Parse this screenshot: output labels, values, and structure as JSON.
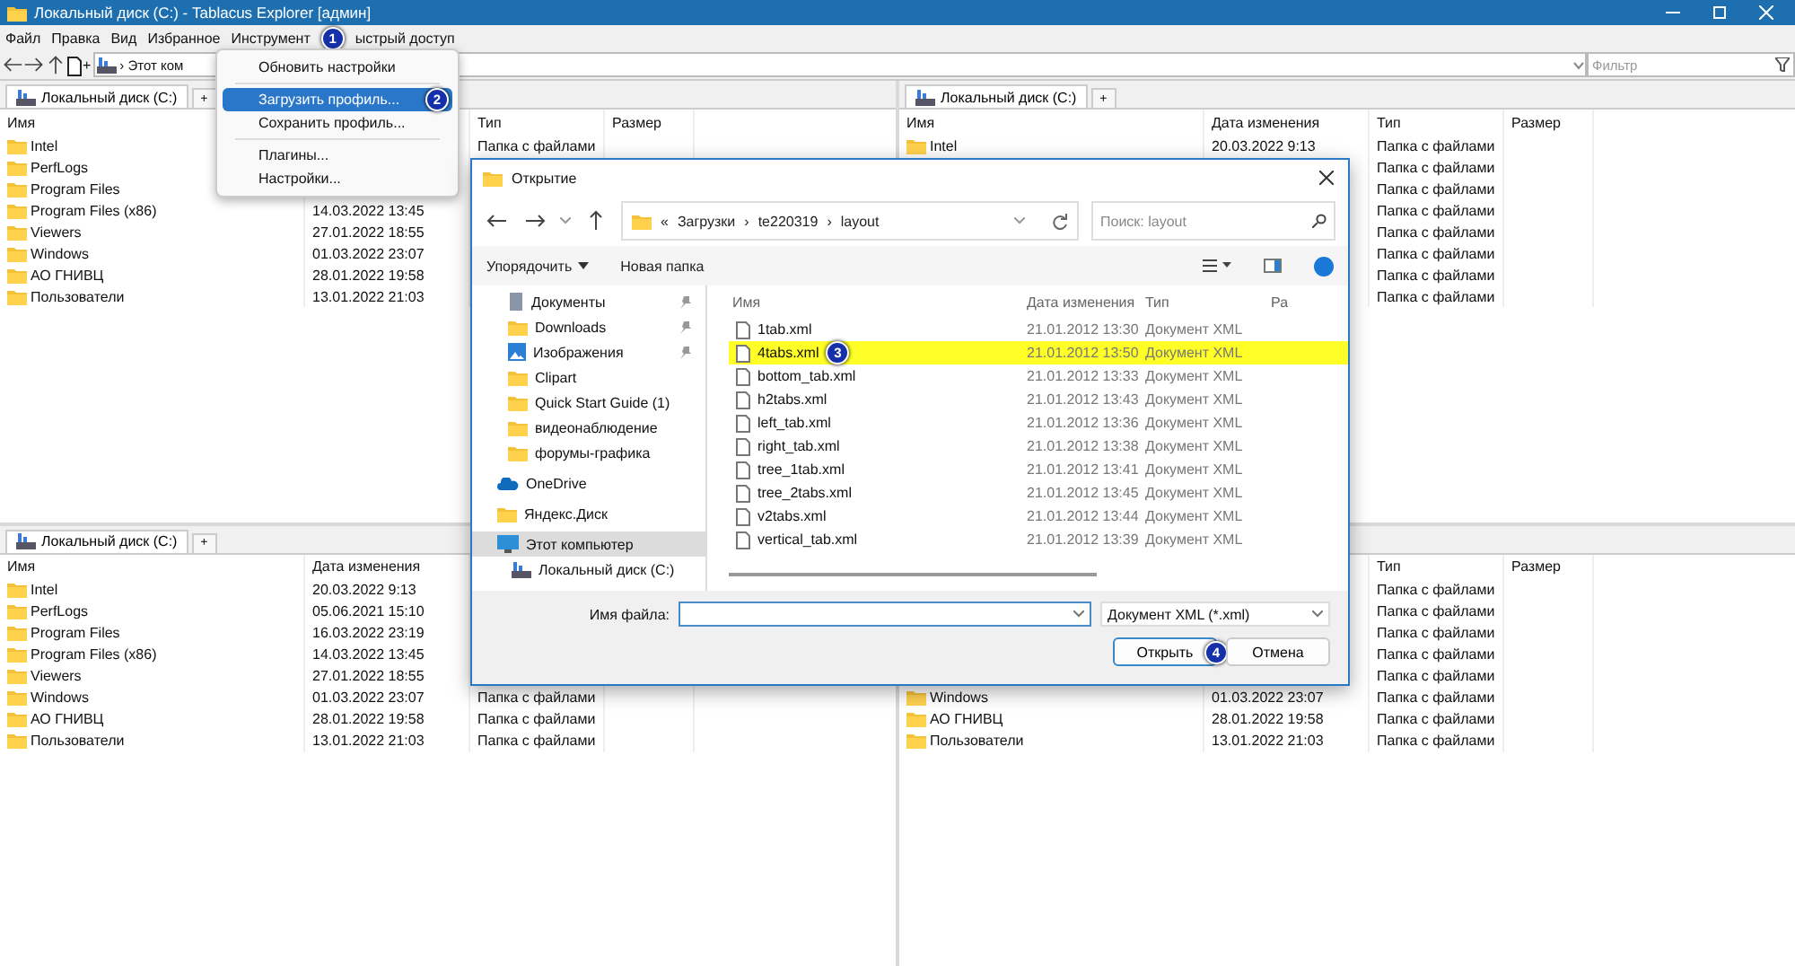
{
  "window": {
    "title": "Локальный диск (C:) - Tablacus Explorer [админ]"
  },
  "menu_bar": [
    {
      "label": "Файл"
    },
    {
      "label": "Правка"
    },
    {
      "label": "Вид"
    },
    {
      "label": "Избранное"
    },
    {
      "label": "Инструмент",
      "badge": "1"
    },
    {
      "label": "ыстрый доступ"
    }
  ],
  "toolbar": {
    "new_tab": "+",
    "address": "› Этот ком",
    "filter_placeholder": "Фильтр"
  },
  "panes": [
    {
      "tab": "Локальный диск (C:)",
      "add_tab": "+",
      "columns": {
        "name": "Имя",
        "type": "Тип",
        "size": "Размер"
      },
      "rows": [
        {
          "name": "Intel",
          "type": "Папка с файлами"
        },
        {
          "name": "PerfLogs"
        },
        {
          "name": "Program Files"
        },
        {
          "name": "Program Files (x86)",
          "date": "14.03.2022 13:45"
        },
        {
          "name": "Viewers",
          "date": "27.01.2022 18:55"
        },
        {
          "name": "Windows",
          "date": "01.03.2022 23:07"
        },
        {
          "name": "АО ГНИВЦ",
          "date": "28.01.2022 19:58"
        },
        {
          "name": "Пользователи",
          "date": "13.01.2022 21:03"
        }
      ]
    },
    {
      "tab": "Локальный диск (C:)",
      "add_tab": "+",
      "columns": {
        "name": "Имя",
        "date": "Дата изменения",
        "type": "Тип",
        "size": "Размер"
      },
      "rows": [
        {
          "name": "Intel",
          "date": "20.03.2022 9:13",
          "type": "Папка с файлами"
        },
        {
          "type": "Папка с файлами"
        },
        {
          "type": "Папка с файлами"
        },
        {
          "type": "Папка с файлами"
        },
        {
          "type": "Папка с файлами"
        },
        {
          "type": "Папка с файлами"
        },
        {
          "type": "Папка с файлами"
        },
        {
          "type": "Папка с файлами"
        }
      ]
    },
    {
      "tab": "Локальный диск (C:)",
      "add_tab": "+",
      "columns": {
        "name": "Имя",
        "date": "Дата изменения"
      },
      "rows": [
        {
          "name": "Intel",
          "date": "20.03.2022 9:13"
        },
        {
          "name": "PerfLogs",
          "date": "05.06.2021 15:10"
        },
        {
          "name": "Program Files",
          "date": "16.03.2022 23:19"
        },
        {
          "name": "Program Files (x86)",
          "date": "14.03.2022 13:45"
        },
        {
          "name": "Viewers",
          "date": "27.01.2022 18:55"
        },
        {
          "name": "Windows",
          "date": "01.03.2022 23:07",
          "type": "Папка с файлами"
        },
        {
          "name": "АО ГНИВЦ",
          "date": "28.01.2022 19:58",
          "type": "Папка с файлами"
        },
        {
          "name": "Пользователи",
          "date": "13.01.2022 21:03",
          "type": "Папка с файлами"
        }
      ]
    },
    {
      "columns": {
        "type": "Тип",
        "size": "Размер"
      },
      "rows": [
        {
          "type": "Папка с файлами"
        },
        {
          "type": "Папка с файлами"
        },
        {
          "type": "Папка с файлами"
        },
        {
          "type": "Папка с файлами"
        },
        {
          "type": "Папка с файлами"
        },
        {
          "name": "Windows",
          "date": "01.03.2022 23:07",
          "type": "Папка с файлами"
        },
        {
          "name": "АО ГНИВЦ",
          "date": "28.01.2022 19:58",
          "type": "Папка с файлами"
        },
        {
          "name": "Пользователи",
          "date": "13.01.2022 21:03",
          "type": "Папка с файлами"
        }
      ]
    }
  ],
  "tools_menu": [
    {
      "kind": "item",
      "label": "Обновить настройки",
      "highlighted": false
    },
    {
      "kind": "separator"
    },
    {
      "kind": "item",
      "label": "Загрузить профиль...",
      "highlighted": true,
      "badge": "2"
    },
    {
      "kind": "item",
      "label": "Сохранить профиль...",
      "highlighted": false
    },
    {
      "kind": "separator"
    },
    {
      "kind": "item",
      "label": "Плагины...",
      "highlighted": false
    },
    {
      "kind": "item",
      "label": "Настройки...",
      "highlighted": false
    }
  ],
  "open_dialog": {
    "title": "Открытие",
    "path": [
      {
        "label": "Загрузки"
      },
      {
        "label": "te220319"
      },
      {
        "label": "layout"
      }
    ],
    "path_overflow": "«",
    "path_separator": "›",
    "search_placeholder": "Поиск: layout",
    "organize": "Упорядочить",
    "new_folder": "Новая папка",
    "nav": [
      {
        "kind": "documents",
        "label": "Документы",
        "pinned": true,
        "selected": false
      },
      {
        "kind": "folder",
        "label": "Downloads",
        "pinned": true,
        "selected": false
      },
      {
        "kind": "pictures",
        "label": "Изображения",
        "pinned": true,
        "selected": false
      },
      {
        "kind": "folder",
        "label": "Clipart",
        "pinned": false,
        "selected": false
      },
      {
        "kind": "folder",
        "label": "Quick Start Guide (1)",
        "pinned": false,
        "selected": false
      },
      {
        "kind": "folder",
        "label": "видеонаблюдение",
        "pinned": false,
        "selected": false
      },
      {
        "kind": "folder",
        "label": "форумы-графика",
        "pinned": false,
        "selected": false
      },
      {
        "kind": "onedrive",
        "label": "OneDrive",
        "pinned": false,
        "selected": false,
        "top": true
      },
      {
        "kind": "folder",
        "label": "Яндекс.Диск",
        "pinned": false,
        "selected": false,
        "top": true
      },
      {
        "kind": "pc",
        "label": "Этот компьютер",
        "pinned": false,
        "selected": true,
        "top": true,
        "children": [
          {
            "kind": "drive",
            "label": "Локальный диск (C:)",
            "pinned": false,
            "selected": false
          }
        ]
      }
    ],
    "columns": [
      "Имя",
      "Дата изменения",
      "Тип",
      "Ра"
    ],
    "files": [
      {
        "name": "1tab.xml",
        "date": "21.01.2012 13:30",
        "type": "Документ XML",
        "highlighted": false
      },
      {
        "name": "4tabs.xml",
        "date": "21.01.2012 13:50",
        "type": "Документ XML",
        "highlighted": true,
        "badge": "3"
      },
      {
        "name": "bottom_tab.xml",
        "date": "21.01.2012 13:33",
        "type": "Документ XML",
        "highlighted": false
      },
      {
        "name": "h2tabs.xml",
        "date": "21.01.2012 13:43",
        "type": "Документ XML",
        "highlighted": false
      },
      {
        "name": "left_tab.xml",
        "date": "21.01.2012 13:36",
        "type": "Документ XML",
        "highlighted": false
      },
      {
        "name": "right_tab.xml",
        "date": "21.01.2012 13:38",
        "type": "Документ XML",
        "highlighted": false
      },
      {
        "name": "tree_1tab.xml",
        "date": "21.01.2012 13:41",
        "type": "Документ XML",
        "highlighted": false
      },
      {
        "name": "tree_2tabs.xml",
        "date": "21.01.2012 13:45",
        "type": "Документ XML",
        "highlighted": false
      },
      {
        "name": "v2tabs.xml",
        "date": "21.01.2012 13:44",
        "type": "Документ XML",
        "highlighted": false
      },
      {
        "name": "vertical_tab.xml",
        "date": "21.01.2012 13:39",
        "type": "Документ XML",
        "highlighted": false
      }
    ],
    "filename_label": "Имя файла:",
    "filetype": "Документ XML (*.xml)",
    "buttons": [
      {
        "label": "Открыть",
        "primary": true,
        "badge": "4"
      },
      {
        "label": "Отмена",
        "primary": false
      }
    ]
  }
}
